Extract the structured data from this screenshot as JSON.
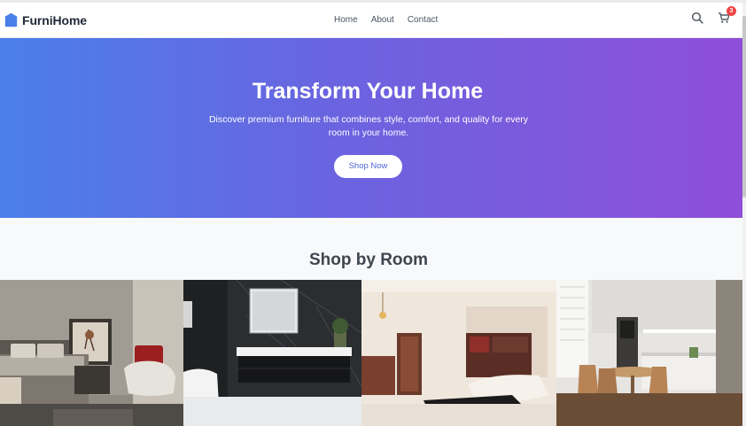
{
  "header": {
    "brand": "FurniHome",
    "nav": [
      {
        "label": "Home"
      },
      {
        "label": "About"
      },
      {
        "label": "Contact"
      }
    ],
    "cart_count": "3",
    "icons": {
      "brand": "house-icon",
      "search": "search-icon",
      "cart": "cart-icon"
    }
  },
  "hero": {
    "title": "Transform Your Home",
    "subtitle": "Discover premium furniture that combines style, comfort, and quality for every room in your home.",
    "button": "Shop Now",
    "gradient": [
      "#4b7fe8",
      "#8f4ed8"
    ]
  },
  "rooms_section": {
    "title": "Shop by Room",
    "cards": [
      {
        "scene": "bedroom"
      },
      {
        "scene": "bathroom"
      },
      {
        "scene": "living-room"
      },
      {
        "scene": "kitchen"
      }
    ]
  },
  "colors": {
    "accent": "#4f64d8",
    "badge": "#ef4444",
    "text_dark": "#1f2937"
  }
}
